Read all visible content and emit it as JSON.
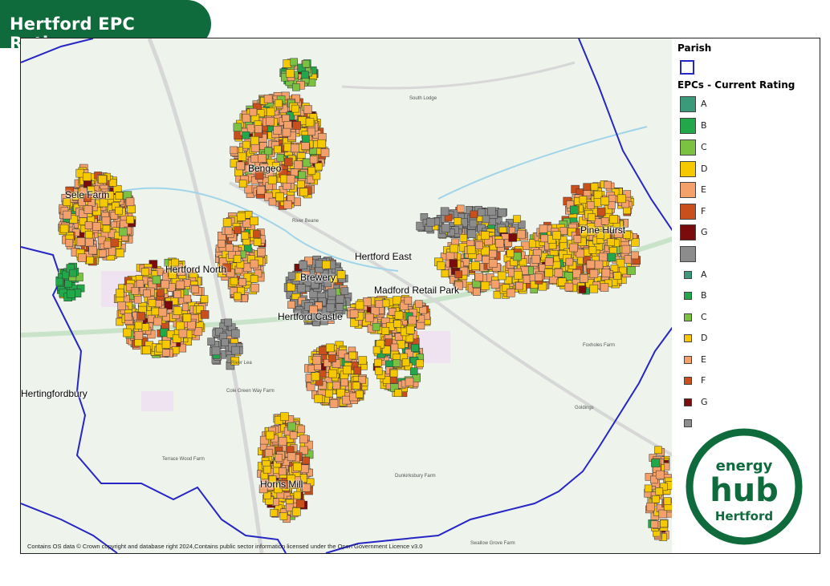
{
  "title": "Hertford EPC Ratings",
  "legend": {
    "parish_heading": "Parish",
    "parish_color": "#2626c4",
    "epc_heading": "EPCs - Current Rating",
    "ratings_large": [
      {
        "label": "A",
        "color": "#3a9a7a"
      },
      {
        "label": "B",
        "color": "#22a84a"
      },
      {
        "label": "C",
        "color": "#7cc242"
      },
      {
        "label": "D",
        "color": "#f5c800"
      },
      {
        "label": "E",
        "color": "#f3a06b"
      },
      {
        "label": "F",
        "color": "#c9501c"
      },
      {
        "label": "G",
        "color": "#7a0c0c"
      },
      {
        "label": "",
        "color": "#8c8c8c"
      }
    ],
    "ratings_small": [
      {
        "label": "A",
        "color": "#3a9a7a"
      },
      {
        "label": "B",
        "color": "#22a84a"
      },
      {
        "label": "C",
        "color": "#7cc242"
      },
      {
        "label": "D",
        "color": "#f5c800"
      },
      {
        "label": "E",
        "color": "#f3a06b"
      },
      {
        "label": "F",
        "color": "#c9501c"
      },
      {
        "label": "G",
        "color": "#7a0c0c"
      },
      {
        "label": "",
        "color": "#8c8c8c"
      }
    ]
  },
  "map": {
    "place_labels": [
      "Bengeo",
      "Sele Farm",
      "Hertford North",
      "Brewery",
      "Hertford East",
      "Madford Retail Park",
      "Hertford Castle",
      "Pine Hurst",
      "Hertingfordbury",
      "Horns Mill"
    ],
    "minor_labels": [
      "South Lodge",
      "River Beane",
      "River Lea",
      "Foxholes Farm",
      "Goldings",
      "Terrace Wood Farm",
      "Dunkirksbury Farm",
      "Swallow Grove Farm",
      "Cole Green Way Farm"
    ],
    "attribution": "Contains OS data © Crown copyright and database right 2024,Contains public sector information licensed under the Open Government Licence v3.0"
  },
  "logo": {
    "line1": "energy",
    "line2": "hub",
    "line3": "Hertford",
    "color": "#0f6b3c"
  }
}
